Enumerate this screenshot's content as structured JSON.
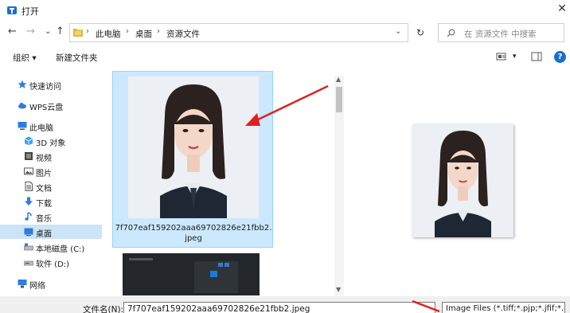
{
  "window": {
    "title": "打开"
  },
  "nav": {
    "back": "←",
    "forward": "→",
    "recent": "⌄",
    "up": "↑"
  },
  "address": {
    "crumbs": [
      "此电脑",
      "桌面",
      "资源文件"
    ],
    "dropdown": "⌄"
  },
  "refresh": "↻",
  "search": {
    "placeholder": "在 资源文件 中搜索"
  },
  "toolbar": {
    "organize": "组织 ▾",
    "new_folder": "新建文件夹",
    "view_dropdown": "▾",
    "help": "?"
  },
  "sidebar": {
    "items": [
      {
        "label": "快速访问",
        "icon": "star-icon"
      },
      {
        "label": "WPS云盘",
        "icon": "cloud-icon"
      },
      {
        "label": "此电脑",
        "icon": "computer-icon"
      },
      {
        "label": "3D 对象",
        "icon": "cube-icon"
      },
      {
        "label": "视频",
        "icon": "video-icon"
      },
      {
        "label": "图片",
        "icon": "image-icon"
      },
      {
        "label": "文档",
        "icon": "document-icon"
      },
      {
        "label": "下载",
        "icon": "download-icon"
      },
      {
        "label": "音乐",
        "icon": "music-icon"
      },
      {
        "label": "桌面",
        "icon": "desktop-icon"
      },
      {
        "label": "本地磁盘 (C:)",
        "icon": "drive-icon"
      },
      {
        "label": "软件 (D:)",
        "icon": "drive-icon"
      },
      {
        "label": "网络",
        "icon": "network-icon"
      }
    ],
    "selected": "桌面"
  },
  "files": [
    {
      "name": "7f707eaf159202aaa69702826e21fbb2.jpeg",
      "selected": true
    }
  ],
  "bottom": {
    "filename_label": "文件名(N):",
    "filename_value": "7f707eaf159202aaa69702826e21fbb2.jpeg",
    "filetype_value": "Image Files (*.tiff;*.pjp;*.jfif;*."
  },
  "colors": {
    "selection": "#cce8ff",
    "accent": "#1a6fd1",
    "arrow": "#e02020"
  }
}
